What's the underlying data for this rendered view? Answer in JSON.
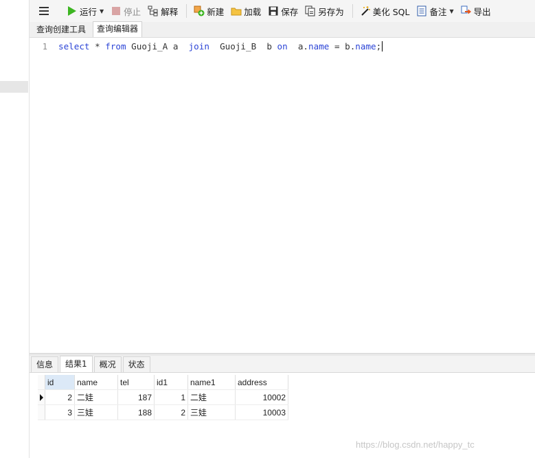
{
  "toolbar": {
    "run": "运行",
    "stop": "停止",
    "explain": "解释",
    "new": "新建",
    "load": "加载",
    "save": "保存",
    "save_as": "另存为",
    "beautify": "美化 SQL",
    "note": "备注",
    "export": "导出"
  },
  "tabs": {
    "query_builder": "查询创建工具",
    "query_editor": "查询编辑器"
  },
  "editor": {
    "line_number": "1",
    "tokens": {
      "t1": "select",
      "t2": " * ",
      "t3": "from",
      "t4": " Guoji_A a  ",
      "t5": "join",
      "t6": "  Guoji_B  b ",
      "t7": "on",
      "t8": "  a.",
      "t9": "name",
      "t10": " = b.",
      "t11": "name",
      "t12": ";"
    }
  },
  "result_tabs": {
    "info": "信息",
    "result1": "结果1",
    "profile": "概况",
    "status": "状态"
  },
  "results": {
    "columns": [
      "id",
      "name",
      "tel",
      "id1",
      "name1",
      "address"
    ],
    "rows": [
      [
        "2",
        "二娃",
        "187",
        "1",
        "二娃",
        "10002"
      ],
      [
        "3",
        "三娃",
        "188",
        "2",
        "三娃",
        "10003"
      ]
    ]
  },
  "watermark": "https://blog.csdn.net/happy_tc",
  "colors": {
    "keyword": "#2b44d6",
    "run_icon": "#3cb521",
    "stop_icon": "#d9a4a4",
    "selected_header": "#dce9f7"
  }
}
